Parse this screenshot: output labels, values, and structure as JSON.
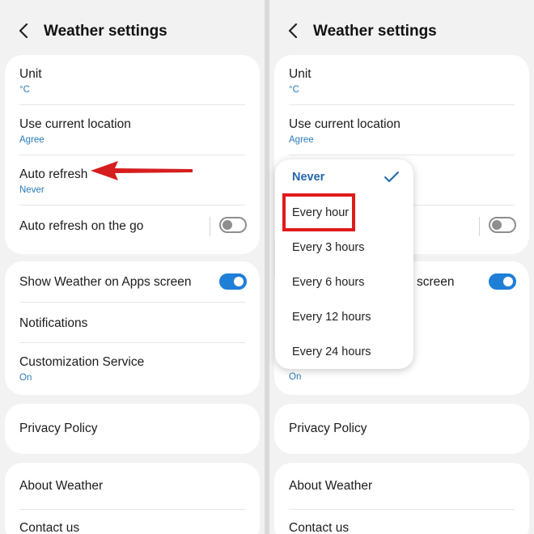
{
  "left_screen": {
    "title": "Weather settings",
    "unit": {
      "label": "Unit",
      "value": "°C"
    },
    "use_location": {
      "label": "Use current location",
      "value": "Agree"
    },
    "auto_refresh": {
      "label": "Auto refresh",
      "value": "Never"
    },
    "auto_refresh_go": {
      "label": "Auto refresh on the go",
      "toggle": "off"
    },
    "show_weather": {
      "label": "Show Weather on Apps screen",
      "toggle": "on"
    },
    "notifications": {
      "label": "Notifications"
    },
    "customization": {
      "label": "Customization Service",
      "value": "On"
    },
    "privacy": {
      "label": "Privacy Policy"
    },
    "about": {
      "label": "About Weather"
    },
    "contact": {
      "label": "Contact us"
    }
  },
  "right_screen": {
    "title": "Weather settings",
    "unit": {
      "label": "Unit",
      "value": "°C"
    },
    "use_location": {
      "label": "Use current location",
      "value": "Agree"
    },
    "show_weather_partial": "screen",
    "customization_value": "On",
    "privacy": {
      "label": "Privacy Policy"
    },
    "about": {
      "label": "About Weather"
    },
    "contact": {
      "label": "Contact us"
    }
  },
  "refresh_menu": {
    "options": [
      "Never",
      "Every hour",
      "Every 3 hours",
      "Every 6 hours",
      "Every 12 hours",
      "Every 24 hours"
    ],
    "selected": "Never",
    "highlighted": "Every hour"
  },
  "colors": {
    "accent": "#2a7ab8",
    "toggle_on": "#1f7fd6",
    "highlight_red": "#e01a1a"
  },
  "icons": [
    "back-arrow-icon",
    "checkmark-icon",
    "red-pointer-arrow"
  ]
}
